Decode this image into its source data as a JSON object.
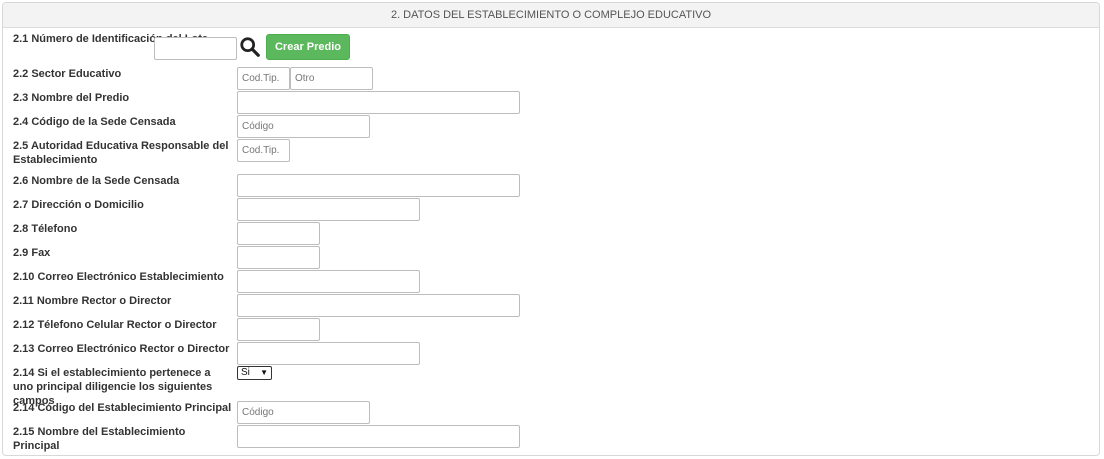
{
  "section": {
    "title": "2. DATOS DEL ESTABLECIMIENTO O COMPLEJO EDUCATIVO"
  },
  "fields": {
    "f21": {
      "label": "2.1 Número de Identificación del Lote",
      "value": ""
    },
    "f22": {
      "label": "2.2 Sector Educativo",
      "cod_placeholder": "Cod.Tip.",
      "otro_placeholder": "Otro"
    },
    "f23": {
      "label": "2.3 Nombre del Predio",
      "value": ""
    },
    "f24": {
      "label": "2.4 Código de la Sede Censada",
      "placeholder": "Código"
    },
    "f25": {
      "label": "2.5 Autoridad Educativa Responsable del Establecimiento",
      "placeholder": "Cod.Tip."
    },
    "f26": {
      "label": "2.6 Nombre de la Sede Censada",
      "value": ""
    },
    "f27": {
      "label": "2.7 Dirección o Domicilio",
      "value": ""
    },
    "f28": {
      "label": "2.8 Télefono",
      "value": ""
    },
    "f29": {
      "label": "2.9 Fax",
      "value": ""
    },
    "f210": {
      "label": "2.10 Correo Electrónico Establecimiento",
      "value": ""
    },
    "f211": {
      "label": "2.11 Nombre Rector o Director",
      "value": ""
    },
    "f212": {
      "label": "2.12 Télefono Celular Rector o Director",
      "value": ""
    },
    "f213": {
      "label": "2.13 Correo Electrónico Rector o Director",
      "value": ""
    },
    "f214a": {
      "label": "2.14 Si el establecimiento pertenece a uno principal diligencie los siguientes campos",
      "selected": "Si"
    },
    "f214b": {
      "label": "2.14 Código del Establecimiento Principal",
      "placeholder": "Código"
    },
    "f215": {
      "label": "2.15 Nombre del Establecimiento Principal",
      "value": ""
    }
  },
  "actions": {
    "crear_predio": "Crear Predio"
  },
  "colors": {
    "button_green": "#5cb85c",
    "header_bg": "#f3f3f3"
  },
  "icons": {
    "search": "search-icon"
  }
}
